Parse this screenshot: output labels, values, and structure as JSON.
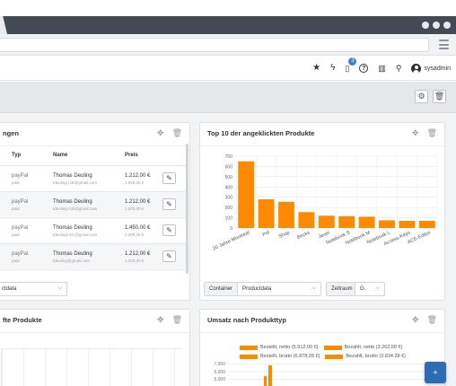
{
  "header": {
    "notification_count": "3",
    "username": "sysadmin",
    "icons": [
      "star-icon",
      "flash-icon",
      "document-icon",
      "help-icon",
      "grid-icon",
      "search-icon",
      "user-icon"
    ]
  },
  "orders_panel": {
    "title": "ngen",
    "columns": {
      "typ": "Typ",
      "name": "Name",
      "preis": "Preis"
    },
    "rows": [
      {
        "typ": "payPal",
        "status": "paid",
        "name": "Thomas Deuling",
        "email": "tdeuling+1E@gmail.com",
        "price": "1.212,00 €",
        "price_net": "1.000,00 €"
      },
      {
        "typ": "payPal",
        "status": "paid",
        "name": "Thomas Deuling",
        "email": "tdeuling+1D@gmail.com",
        "price": "1.212,00 €",
        "price_net": "1.000,00 €"
      },
      {
        "typ": "payPal",
        "status": "paid",
        "name": "Thomas Deuling",
        "email": "tdeuling+1C@gmail.com",
        "price": "1.450,00 €",
        "price_net": "1.200,00 €"
      },
      {
        "typ": "payPal",
        "status": "paid",
        "name": "Thomas Deuling",
        "email": "tdeuling@gmail.com",
        "price": "1.212,00 €",
        "price_net": "1.000,00 €"
      }
    ],
    "filter_value": "ctdata"
  },
  "top10_panel": {
    "title": "Top 10 der angeklickten Produkte",
    "container_label": "Container",
    "container_value": "Productdata",
    "zeitraum_label": "Zeitraum",
    "zeitraum_value": "G."
  },
  "bestseller_panel": {
    "title": "fte Produkte"
  },
  "umsatz_panel": {
    "title": "Umsatz nach Produkttyp",
    "legend": [
      "Bestellt, netto (5.912,00 €)",
      "Bezahlt, netto (3.262,00 €)",
      "Bestellt, brutto (6.878,28 €)",
      "Bezahlt, brutto (3.834,28 €)"
    ],
    "yticks": [
      "7,000",
      "6,000",
      "5,000"
    ]
  },
  "fab_label": "+",
  "colors": {
    "bar": "#ff8a00",
    "accent": "#3e83c7"
  },
  "chart_data": {
    "type": "bar",
    "title": "Top 10 der angeklickten Produkte",
    "categories": [
      "20 Jahre Montreal",
      "Pril",
      "Shop",
      "Becks",
      "Jever",
      "Notebook S",
      "Notebook M",
      "Notebook L",
      "Access-Keys",
      "ACE-Editor"
    ],
    "values": [
      650,
      280,
      255,
      155,
      120,
      115,
      110,
      75,
      70,
      70
    ],
    "ylim": [
      0,
      700
    ],
    "yticks": [
      0,
      100,
      200,
      300,
      400,
      500,
      600,
      700
    ],
    "grid": true
  }
}
